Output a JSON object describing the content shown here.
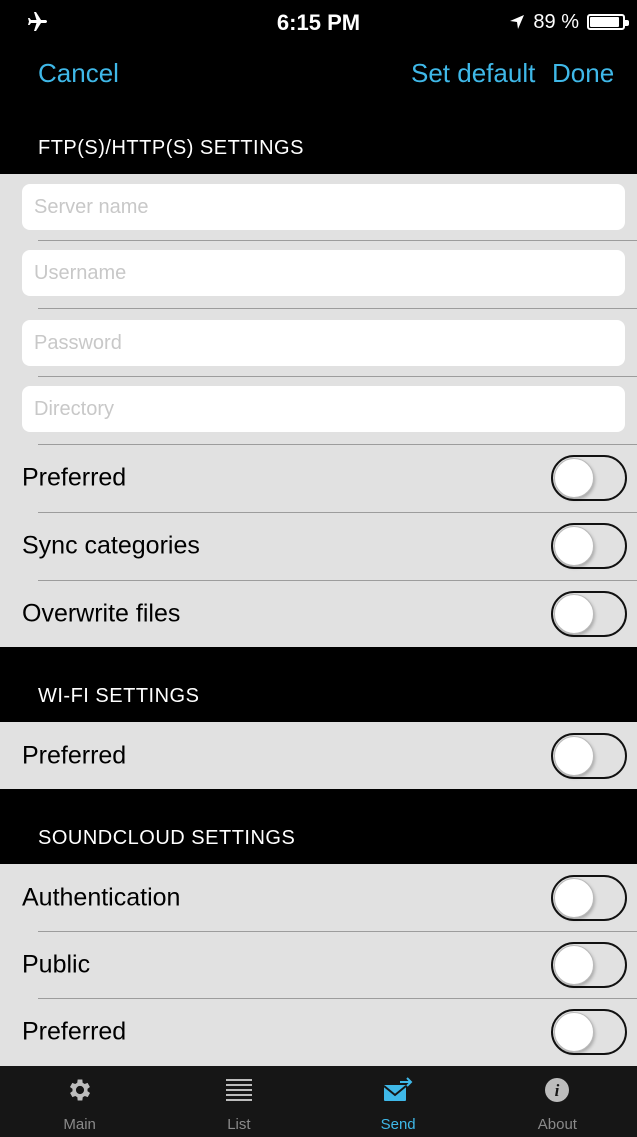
{
  "status_bar": {
    "time": "6:15 PM",
    "battery_text": "89 %",
    "battery_level": 0.89,
    "icons": [
      "airplane-mode-icon",
      "location-arrow-icon",
      "battery-icon"
    ]
  },
  "nav": {
    "cancel_label": "Cancel",
    "set_default_label": "Set default",
    "done_label": "Done",
    "accent_color": "#3fb8e8"
  },
  "ftp_section": {
    "header": "FTP(S)/HTTP(S) SETTINGS",
    "server_name": {
      "value": "",
      "placeholder": "Server name"
    },
    "username": {
      "value": "",
      "placeholder": "Username"
    },
    "password": {
      "value": "",
      "placeholder": "Password"
    },
    "directory": {
      "value": "",
      "placeholder": "Directory"
    },
    "toggles": [
      {
        "label": "Preferred",
        "on": false
      },
      {
        "label": "Sync categories",
        "on": false
      },
      {
        "label": "Overwrite files",
        "on": false
      }
    ]
  },
  "wifi_section": {
    "header": "WI-FI SETTINGS",
    "toggles": [
      {
        "label": "Preferred",
        "on": false
      }
    ]
  },
  "soundcloud_section": {
    "header": "SOUNDCLOUD SETTINGS",
    "toggles": [
      {
        "label": "Authentication",
        "on": false
      },
      {
        "label": "Public",
        "on": false
      },
      {
        "label": "Preferred",
        "on": false
      }
    ]
  },
  "tab_bar": {
    "active_index": 2,
    "tabs": [
      {
        "label": "Main",
        "icon": "gear-icon"
      },
      {
        "label": "List",
        "icon": "list-lines-icon"
      },
      {
        "label": "Send",
        "icon": "send-envelope-icon"
      },
      {
        "label": "About",
        "icon": "info-icon"
      }
    ]
  }
}
